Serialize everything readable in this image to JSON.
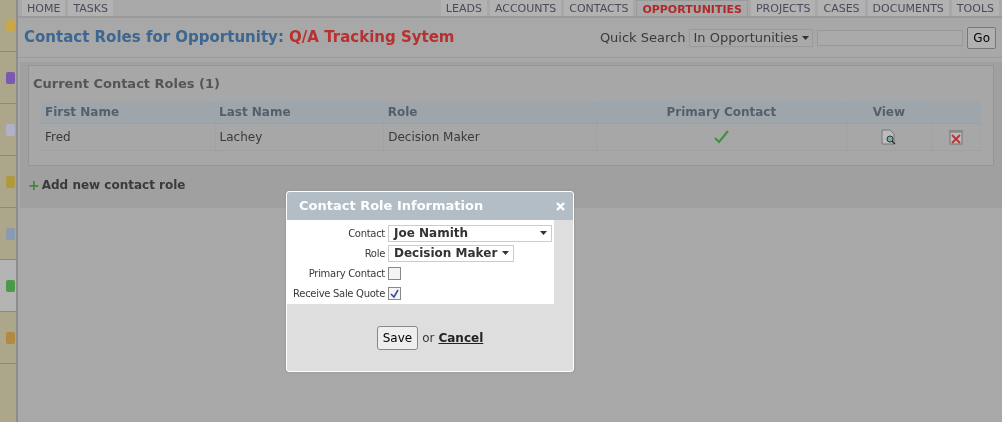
{
  "left_tabs": [
    {
      "label": "HOME",
      "selected": false
    },
    {
      "label": "TASKS",
      "selected": false
    }
  ],
  "right_tabs": [
    {
      "label": "LEADS",
      "selected": false
    },
    {
      "label": "ACCOUNTS",
      "selected": false
    },
    {
      "label": "CONTACTS",
      "selected": false
    },
    {
      "label": "OPPORTUNITIES",
      "selected": true
    },
    {
      "label": "PROJECTS",
      "selected": false
    },
    {
      "label": "CASES",
      "selected": false
    },
    {
      "label": "DOCUMENTS",
      "selected": false
    },
    {
      "label": "TOOLS",
      "selected": false
    }
  ],
  "title": {
    "prefix": "Contact Roles for Opportunity:",
    "name": "Q/A Tracking Sytem"
  },
  "quick_search": {
    "label": "Quick Search",
    "scope": "In Opportunities",
    "button": "Go"
  },
  "panel": {
    "title": "Current Contact Roles (1)",
    "columns": [
      "First Name",
      "Last Name",
      "Role",
      "Primary Contact",
      "View"
    ],
    "rows": [
      {
        "first_name": "Fred",
        "last_name": "Lachey",
        "role": "Decision Maker",
        "primary": true
      }
    ]
  },
  "add_link": {
    "icon": "+",
    "label": "Add new contact role"
  },
  "dialog": {
    "title": "Contact Role Information",
    "fields": [
      {
        "kind": "select",
        "label": "Contact",
        "value": "Joe Namith"
      },
      {
        "kind": "select",
        "label": "Role",
        "value": "Decision Maker"
      },
      {
        "kind": "checkbox",
        "label": "Primary Contact",
        "checked": false
      },
      {
        "kind": "checkbox",
        "label": "Receive Sale Quote",
        "checked": true
      }
    ],
    "save": "Save",
    "or": "or",
    "cancel": "Cancel"
  }
}
